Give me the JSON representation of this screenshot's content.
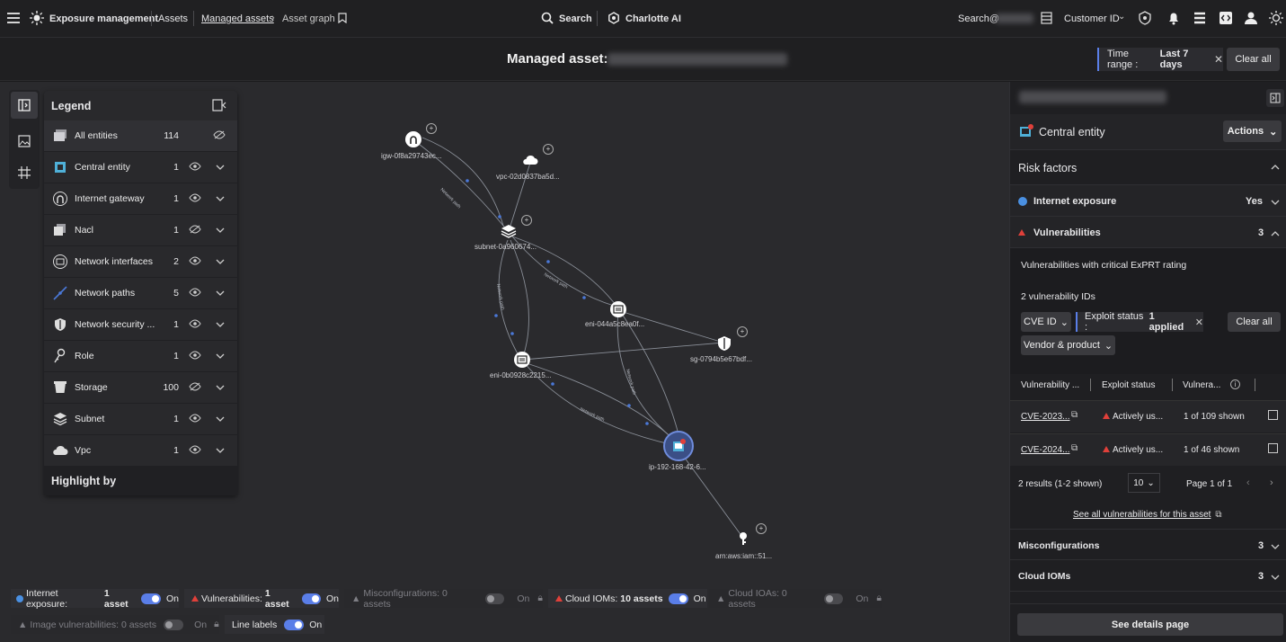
{
  "topbar": {
    "app_title": "Exposure management",
    "crumb1": "Assets",
    "crumb2": "Managed assets",
    "crumb3": "Asset graph",
    "search": "Search",
    "charlotte": "Charlotte AI",
    "search_user": "Search@",
    "customer_id": "Customer ID"
  },
  "header": {
    "title": "Managed asset:",
    "time_range_label": "Time range :",
    "time_range_value": "Last 7 days",
    "clear_all": "Clear all"
  },
  "legend": {
    "title": "Legend",
    "highlight_by": "Highlight by",
    "rows": [
      {
        "name": "All entities",
        "count": "114"
      },
      {
        "name": "Central entity",
        "count": "1"
      },
      {
        "name": "Internet gateway",
        "count": "1"
      },
      {
        "name": "Nacl",
        "count": "1"
      },
      {
        "name": "Network interfaces",
        "count": "2"
      },
      {
        "name": "Network paths",
        "count": "5"
      },
      {
        "name": "Network security ...",
        "count": "1"
      },
      {
        "name": "Role",
        "count": "1"
      },
      {
        "name": "Storage",
        "count": "100"
      },
      {
        "name": "Subnet",
        "count": "1"
      },
      {
        "name": "Vpc",
        "count": "1"
      }
    ]
  },
  "graph": {
    "nodes": [
      {
        "label": "igw-0f8a29743ec..."
      },
      {
        "label": "vpc-02d0837ba5d..."
      },
      {
        "label": "subnet-0a960674..."
      },
      {
        "label": "eni-044a5c8ea0f..."
      },
      {
        "label": "sg-0794b5e67bdf..."
      },
      {
        "label": "eni-0b0928c2215..."
      },
      {
        "label": "ip-192-168-42-6..."
      },
      {
        "label": "arn:aws:iam::51..."
      }
    ],
    "edge_label": "Network path"
  },
  "chips": {
    "internet": {
      "label": "Internet exposure:",
      "value": "1 asset",
      "state": "On"
    },
    "vulns": {
      "label": "Vulnerabilities:",
      "value": "1 asset",
      "state": "On"
    },
    "misconf": {
      "label": "Misconfigurations: 0 assets",
      "state": "On"
    },
    "cloud_ioms": {
      "label": "Cloud IOMs:",
      "value": "10 assets",
      "state": "On"
    },
    "cloud_ioas": {
      "label": "Cloud IOAs: 0 assets",
      "state": "On"
    },
    "image_vulns": {
      "label": "Image vulnerabilities: 0 assets",
      "state": "On"
    },
    "line_labels": {
      "label": "Line labels",
      "state": "On"
    }
  },
  "panel": {
    "central_entity": "Central entity",
    "actions": "Actions",
    "risk_factors": "Risk factors",
    "internet_exposure": "Internet exposure",
    "internet_exposure_value": "Yes",
    "vulnerabilities": "Vulnerabilities",
    "vulnerabilities_count": "3",
    "critical_text": "Vulnerabilities with critical ExPRT rating",
    "vuln_ids": "2 vulnerability IDs",
    "filter_cve": "CVE ID",
    "filter_exploit": "Exploit status :",
    "filter_exploit_value": "1 applied",
    "filter_clear": "Clear all",
    "filter_vendor": "Vendor & product",
    "col1": "Vulnerability ...",
    "col2": "Exploit status",
    "col3": "Vulnera...",
    "rows": [
      {
        "cve": "CVE-2023...",
        "status": "Actively us...",
        "shown": "1 of 109 shown"
      },
      {
        "cve": "CVE-2024...",
        "status": "Actively us...",
        "shown": "1 of 46 shown"
      }
    ],
    "results": "2 results (1-2 shown)",
    "per_page": "10",
    "page": "Page 1 of 1",
    "see_all": "See all vulnerabilities for this asset",
    "misconfigurations": "Misconfigurations",
    "misconfigurations_count": "3",
    "cloud_ioms": "Cloud IOMs",
    "cloud_ioms_count": "3",
    "see_details": "See details page"
  },
  "colors": {
    "accent": "#5a7ee8",
    "danger": "#e0403a",
    "globe": "#4a90e2"
  }
}
